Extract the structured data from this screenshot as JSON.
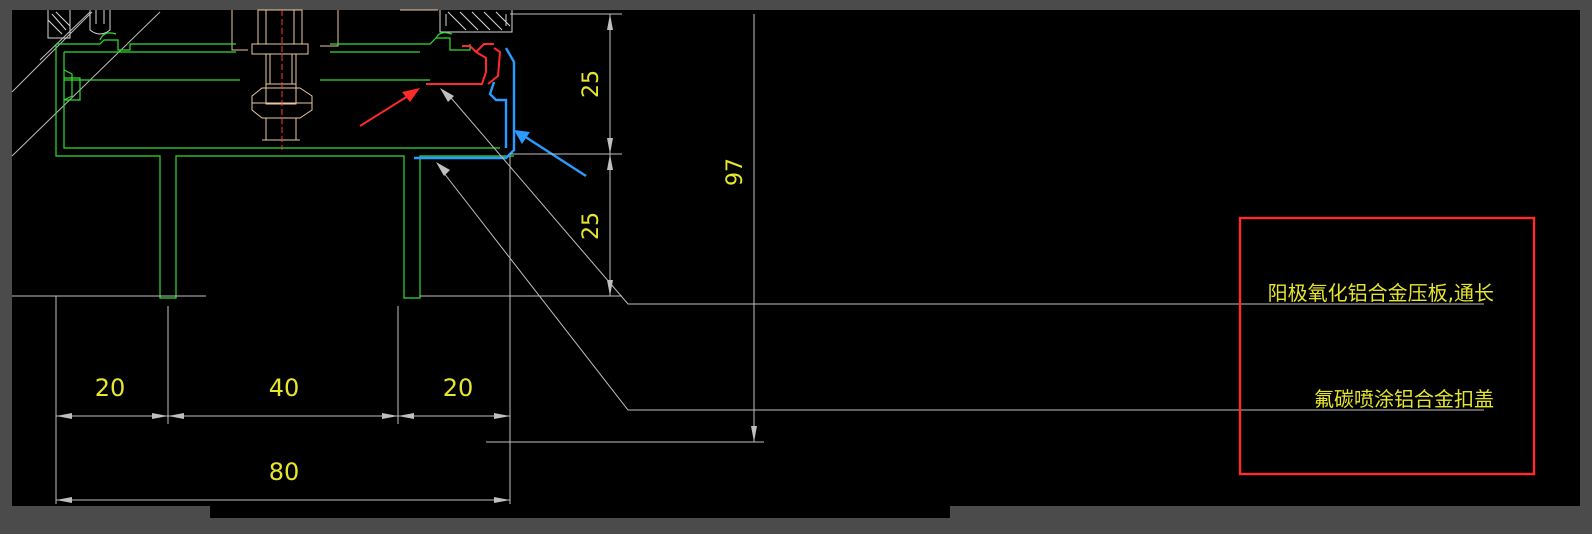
{
  "dimensions": {
    "top_segment": "25",
    "bottom_segment": "25",
    "overall_height": "97",
    "left_flange": "20",
    "middle_gap": "40",
    "right_flange": "20",
    "overall_width": "80"
  },
  "callouts": [
    {
      "text": "阳极氧化铝合金压板,通长"
    },
    {
      "text": "氟碳喷涂铝合金扣盖"
    }
  ],
  "colors": {
    "background": "#000000",
    "frame": "#4b4b4b",
    "profile": "#33dd33",
    "dimension_text": "#e6e62e",
    "callout_text": "#e6e62e",
    "leader": "#bfbfbf",
    "highlight_box": "#ff2b2b",
    "red_arrow": "#ff2b2b",
    "blue_arrow": "#2a9bff",
    "bolt": "#e8c9a0",
    "axis": "#ff3b3b"
  }
}
